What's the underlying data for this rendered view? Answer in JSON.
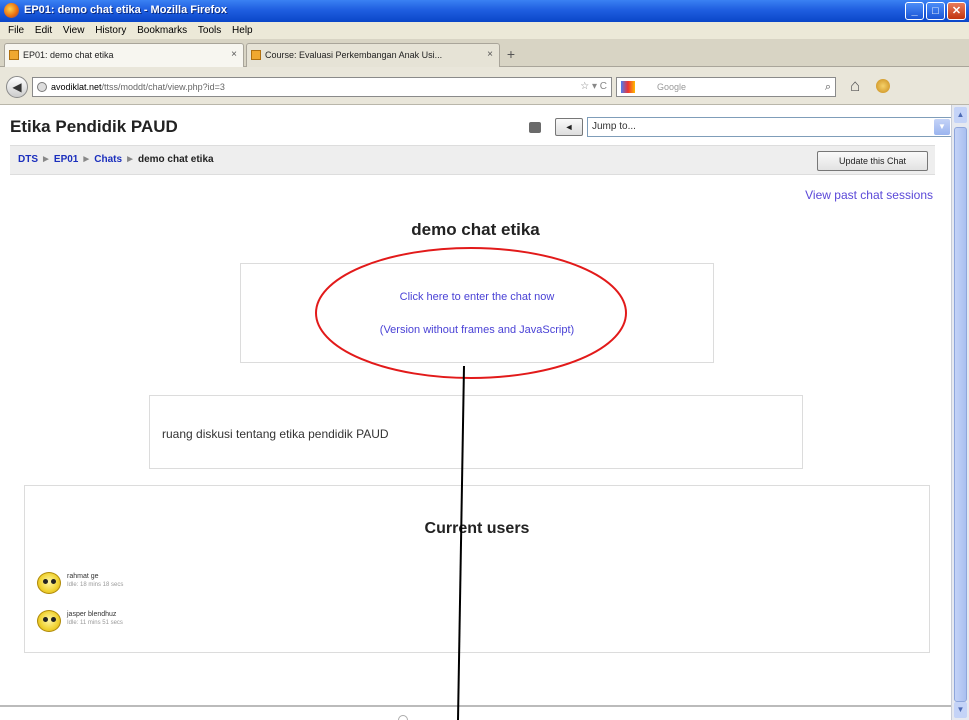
{
  "window": {
    "title": "EP01: demo chat etika - Mozilla Firefox",
    "controls": {
      "minimize": "_",
      "maximize": "□",
      "close": "✕"
    }
  },
  "menu": [
    "File",
    "Edit",
    "View",
    "History",
    "Bookmarks",
    "Tools",
    "Help"
  ],
  "tabs": [
    {
      "label": "EP01: demo chat etika",
      "close": "×"
    },
    {
      "label": "Course: Evaluasi Perkembangan Anak Usi...",
      "close": "×"
    }
  ],
  "new_tab": "+",
  "nav": {
    "back": "◀",
    "url_host": "avodiklat.net",
    "url_rest": "/ttss/moddt/chat/view.php?id=3",
    "url_controls": "☆ ▾ C",
    "search_placeholder": "Google",
    "search_icon": "⌕",
    "home_icon": "⌂"
  },
  "page": {
    "course_title": "Etika Pendidik PAUD",
    "prev_button": "◄",
    "jump_to": "Jump to...",
    "jump_arrow": "▼",
    "breadcrumb": [
      "DTS",
      "EP01",
      "Chats",
      "demo chat etika"
    ],
    "breadcrumb_sep": "►",
    "update_button": "Update this Chat",
    "past_sessions_link": "View past chat sessions",
    "chat_title": "demo chat etika",
    "enter_link": "Click here to enter the chat now",
    "enter_link_noframes": "(Version without frames and JavaScript)",
    "intro_text": "ruang diskusi tentang etika pendidik PAUD",
    "current_users_heading": "Current users",
    "users": [
      {
        "name": "rahmat ge",
        "idle": "Idle: 18 mins 18 secs"
      },
      {
        "name": "jasper blendhuz",
        "idle": "Idle: 11 mins 51 secs"
      }
    ]
  },
  "scrollbar": {
    "up": "▲",
    "down": "▼"
  },
  "annotation": {
    "ellipse_color": "#e21a1a",
    "line_color": "#000000"
  }
}
